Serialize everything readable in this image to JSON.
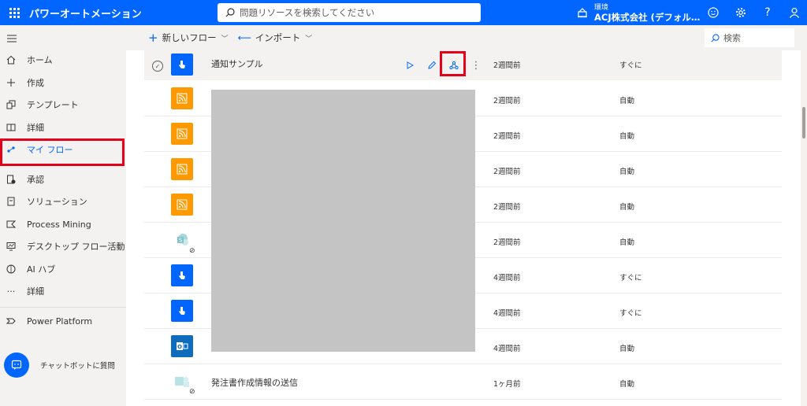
{
  "header": {
    "app_title": "パワーオートメーション",
    "search_placeholder": "問題リソースを検索してください",
    "environment_label": "環境",
    "environment_name": "ACJ株式会社 (デフォル…"
  },
  "sidebar": {
    "items": [
      {
        "label": "ホーム",
        "icon": "home-icon"
      },
      {
        "label": "作成",
        "icon": "plus-icon"
      },
      {
        "label": "テンプレート",
        "icon": "template-icon"
      },
      {
        "label": "詳細",
        "icon": "book-icon"
      },
      {
        "label": "マイ フロー",
        "icon": "flow-icon",
        "selected": true
      },
      {
        "label": "承認",
        "icon": "approval-icon"
      },
      {
        "label": "ソリューション",
        "icon": "solution-icon"
      },
      {
        "label": "Process Mining",
        "icon": "process-mining-icon"
      },
      {
        "label": "デスクトップ フロー活動",
        "icon": "desktop-flow-icon"
      },
      {
        "label": "AI ハブ",
        "icon": "ai-hub-icon"
      },
      {
        "label": "詳細",
        "icon": "more-icon"
      },
      {
        "label": "Power Platform",
        "icon": "power-platform-icon"
      }
    ],
    "chatbot_label": "チャットボットに質問"
  },
  "commandbar": {
    "new_flow": "新しいフロー",
    "import": "インポート",
    "search": "検索"
  },
  "flows": [
    {
      "name": "通知サンプル",
      "modified": "2週間前",
      "type": "すぐに",
      "icon": "button-icon",
      "color": "blue",
      "selected": true
    },
    {
      "name": "",
      "modified": "2週間前",
      "type": "自動",
      "icon": "rss-icon",
      "color": "orange"
    },
    {
      "name": "",
      "modified": "2週間前",
      "type": "自動",
      "icon": "rss-icon",
      "color": "orange"
    },
    {
      "name": "",
      "modified": "2週間前",
      "type": "自動",
      "icon": "rss-icon",
      "color": "orange"
    },
    {
      "name": "",
      "modified": "2週間前",
      "type": "自動",
      "icon": "rss-icon",
      "color": "orange"
    },
    {
      "name": "",
      "modified": "2週間前",
      "type": "自動",
      "icon": "sharepoint-icon",
      "color": "sp",
      "disabled": true
    },
    {
      "name": "",
      "modified": "4週間前",
      "type": "すぐに",
      "icon": "button-icon",
      "color": "blue"
    },
    {
      "name": "",
      "modified": "4週間前",
      "type": "すぐに",
      "icon": "button-icon",
      "color": "blue"
    },
    {
      "name": "",
      "modified": "4週間前",
      "type": "自動",
      "icon": "outlook-icon",
      "color": "outlook"
    },
    {
      "name": "発注書作成情報の送信",
      "modified": "1ヶ月前",
      "type": "自動",
      "icon": "teams-icon",
      "color": "ghost"
    }
  ]
}
